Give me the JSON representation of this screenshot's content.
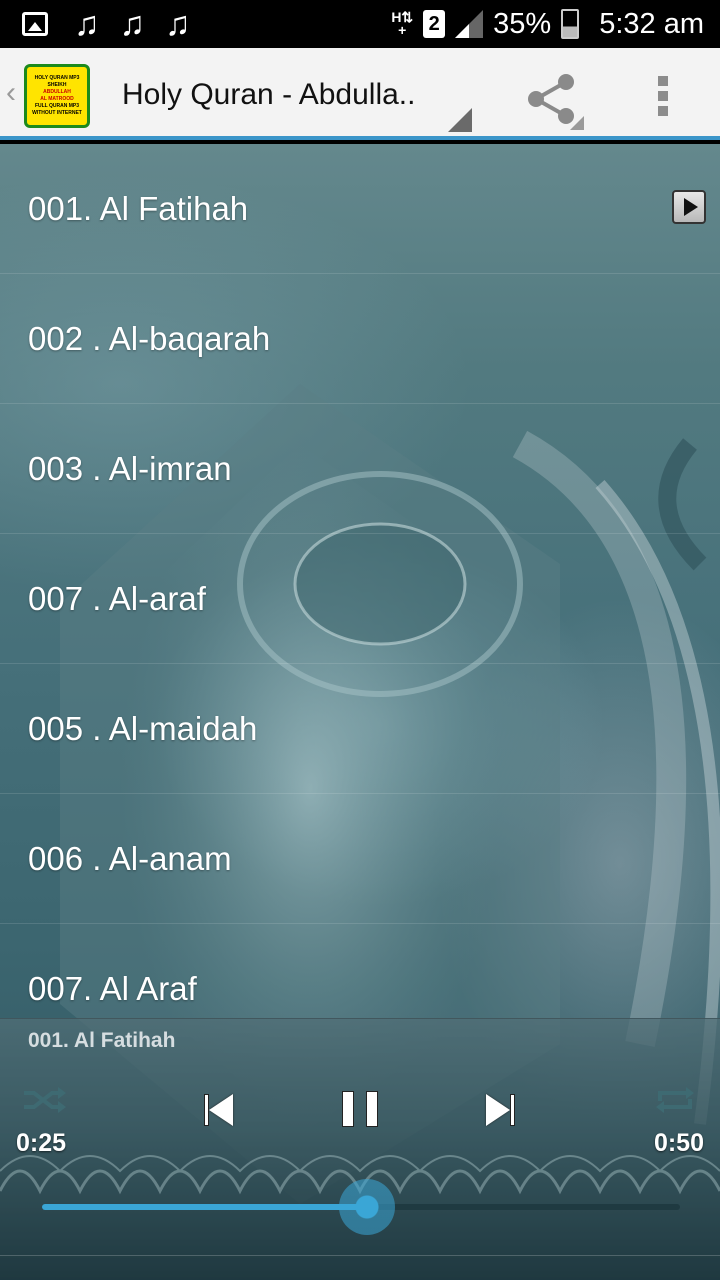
{
  "status_bar": {
    "network": "2",
    "battery": "35%",
    "time": "5:32 am"
  },
  "action_bar": {
    "title": "Holy Quran - Abdulla..",
    "logo_lines": [
      "HOLY QURAN MP3",
      "SHEIKH",
      "ABDULLAH",
      "AL MATROOD",
      "FULL QURAN MP3",
      "WITHOUT INTERNET"
    ]
  },
  "tracks": [
    {
      "title": "001. Al Fatihah"
    },
    {
      "title": "002 . Al-baqarah"
    },
    {
      "title": "003 . Al-imran"
    },
    {
      "title": "007 . Al-araf"
    },
    {
      "title": "005 . Al-maidah"
    },
    {
      "title": "006 . Al-anam"
    },
    {
      "title": "007. Al Araf"
    }
  ],
  "player": {
    "now_playing": "001. Al Fatihah",
    "elapsed": "0:25",
    "total": "0:50",
    "progress": 0.51
  },
  "colors": {
    "accent": "#3aa6d6",
    "action_bar_bg": "#f3f3f3",
    "action_bar_border": "#3b95c9"
  },
  "icons": {
    "status_left": [
      "image-icon",
      "music-note-icon",
      "music-note-icon",
      "music-note-icon"
    ],
    "status_right": [
      "ht-data-icon",
      "sim-icon",
      "signal-icon",
      "battery-icon"
    ],
    "action_bar": [
      "back-chevron-icon",
      "share-icon",
      "overflow-menu-icon"
    ],
    "player": [
      "shuffle-icon",
      "previous-icon",
      "pause-icon",
      "next-icon",
      "repeat-icon"
    ]
  }
}
